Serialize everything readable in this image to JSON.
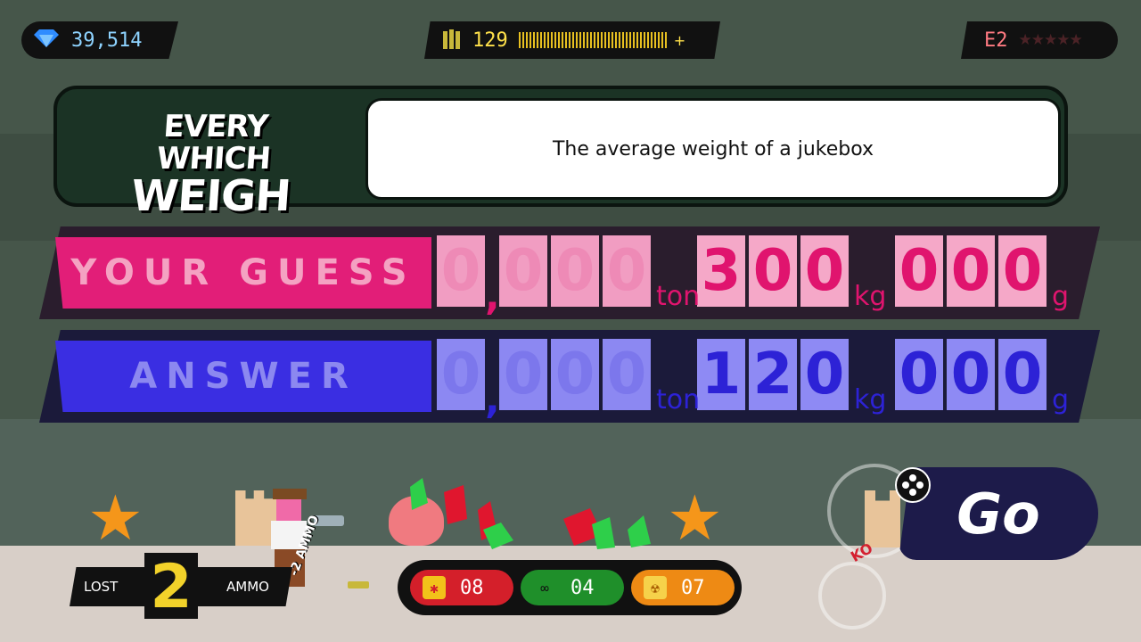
{
  "hud": {
    "gems": "39,514",
    "ammo": "129",
    "ammo_plus": "+",
    "rank": "E2",
    "rank_stars": "★★★★★"
  },
  "question": {
    "logo_line1": "EVERY WHICH",
    "logo_line2": "WEIGH",
    "text": "The average weight of a jukebox"
  },
  "guess": {
    "label": "YOUR GUESS",
    "digits": [
      "0",
      "0",
      "0",
      "0",
      "3",
      "0",
      "0",
      "0",
      "0",
      "0"
    ],
    "comma": ",",
    "unit_ton": "ton",
    "unit_kg": "kg",
    "unit_g": "g"
  },
  "answer": {
    "label": "ANSWER",
    "digits": [
      "0",
      "0",
      "0",
      "0",
      "1",
      "2",
      "0",
      "0",
      "0",
      "0"
    ],
    "comma": ",",
    "unit_ton": "ton",
    "unit_kg": "kg",
    "unit_g": "g"
  },
  "go_button": {
    "label": "Go"
  },
  "status": {
    "lost_label": "LOST",
    "lost_count": "2",
    "ammo_label": "AMMO",
    "floating_text": "-2 AMMO",
    "ko_text": "KO"
  },
  "items": [
    {
      "icon": "bomb-icon",
      "count": "08",
      "color": "#d41f2a"
    },
    {
      "icon": "goggles-icon",
      "count": "04",
      "color": "#1f8f2a"
    },
    {
      "icon": "nuke-icon",
      "count": "07",
      "color": "#ee8a14"
    }
  ],
  "colors": {
    "guess_accent": "#e21e78",
    "answer_accent": "#3a2ee2",
    "ammo_yellow": "#ffe14a",
    "gem_blue": "#8ed3ff"
  }
}
